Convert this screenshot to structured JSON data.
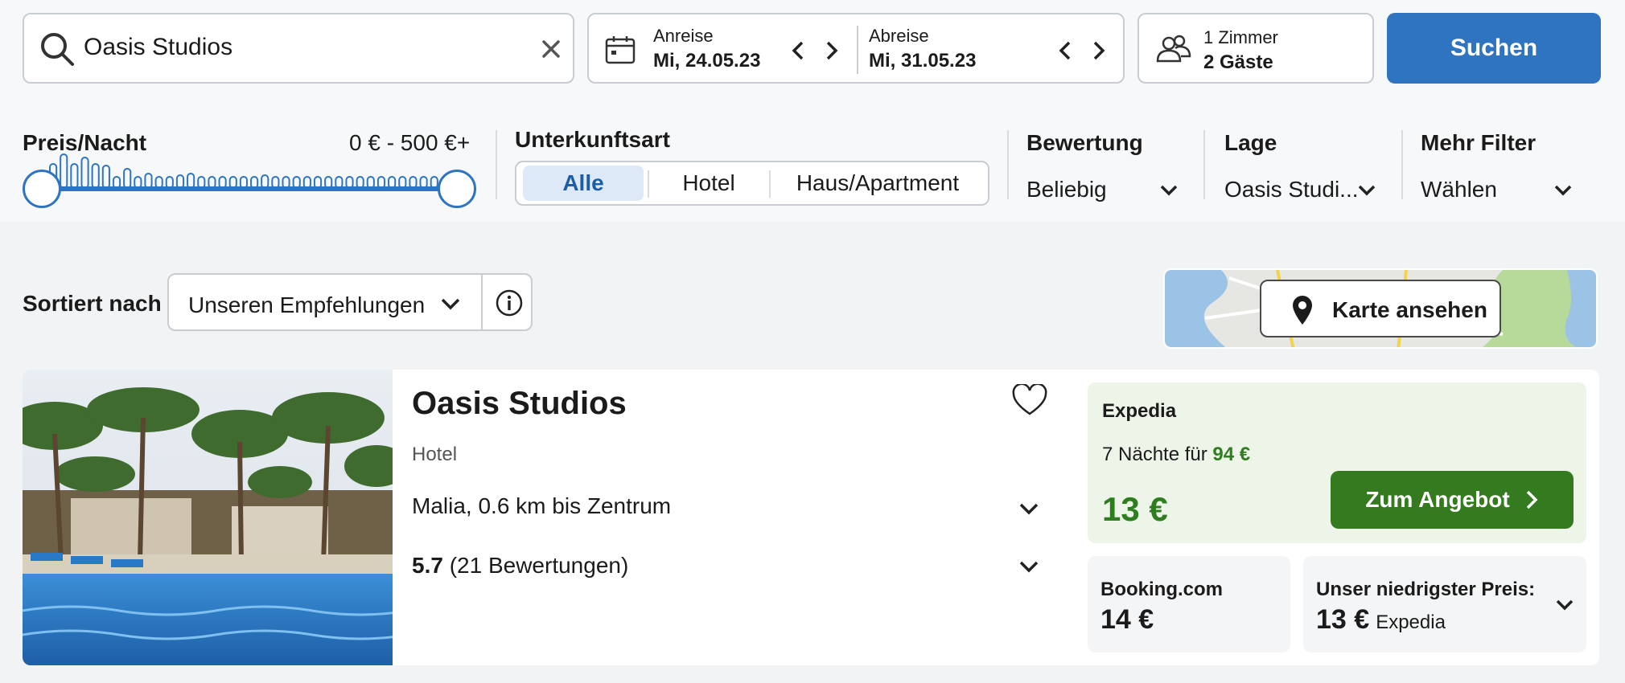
{
  "search": {
    "query": "Oasis Studios"
  },
  "dates": {
    "checkin_label": "Anreise",
    "checkin_value": "Mi, 24.05.23",
    "checkout_label": "Abreise",
    "checkout_value": "Mi, 31.05.23"
  },
  "guests": {
    "rooms": "1 Zimmer",
    "count": "2 Gäste"
  },
  "search_button": "Suchen",
  "filters": {
    "price_title": "Preis/Nacht",
    "price_range": "0 € - 500 €+",
    "price_slider": {
      "min": 0,
      "max": 500
    },
    "accommodation_title": "Unterkunftsart",
    "accommodation_options": [
      "Alle",
      "Hotel",
      "Haus/Apartment"
    ],
    "accommodation_selected": "Alle",
    "rating": {
      "title": "Bewertung",
      "value": "Beliebig"
    },
    "location": {
      "title": "Lage",
      "value": "Oasis Studi..."
    },
    "more": {
      "title": "Mehr Filter",
      "value": "Wählen"
    }
  },
  "sort": {
    "label": "Sortiert nach",
    "value": "Unseren Empfehlungen"
  },
  "map": {
    "button": "Karte ansehen"
  },
  "result": {
    "name": "Oasis Studios",
    "type": "Hotel",
    "location": "Malia, 0.6 km bis Zentrum",
    "rating_score": "5.7",
    "rating_count": "(21 Bewertungen)",
    "offer": {
      "provider": "Expedia",
      "nights_text": "7 Nächte für",
      "nights_price": "94 €",
      "price": "13 €",
      "cta": "Zum Angebot"
    },
    "alt1": {
      "provider": "Booking.com",
      "price": "14 €"
    },
    "alt2": {
      "label": "Unser niedrigster Preis:",
      "price": "13 €",
      "source": "Expedia"
    }
  },
  "colors": {
    "primary": "#2f74c0",
    "success": "#347a1f",
    "offer_bg": "#edf4e8"
  },
  "icons": [
    "search-icon",
    "clear-icon",
    "calendar-icon",
    "chevron-left-icon",
    "chevron-right-icon",
    "guests-icon",
    "chevron-down-icon",
    "info-icon",
    "map-pin-icon",
    "heart-icon"
  ]
}
